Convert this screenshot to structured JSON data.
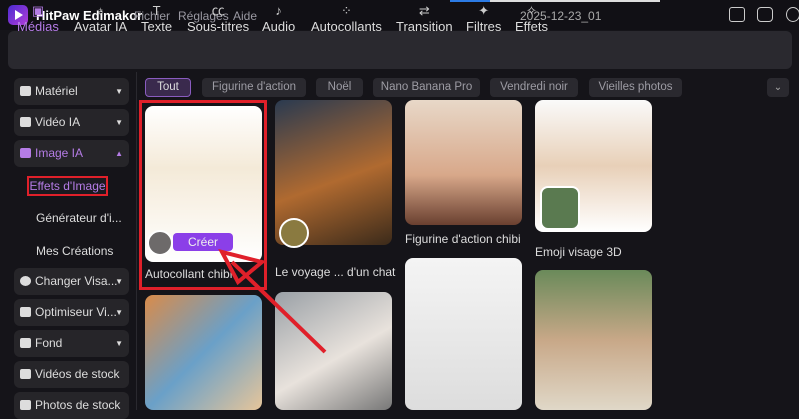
{
  "app": {
    "name": "HitPaw Edimakor",
    "menus": [
      "Fichier",
      "Réglages",
      "Aide"
    ],
    "document": "2025-12-23_01"
  },
  "toolbar": [
    {
      "label": "Médias",
      "icon": "image-icon",
      "active": true
    },
    {
      "label": "Avatar IA",
      "icon": "avatar-icon"
    },
    {
      "label": "Texte",
      "icon": "text-icon"
    },
    {
      "label": "Sous-titres",
      "icon": "subtitles-icon"
    },
    {
      "label": "Audio",
      "icon": "music-icon"
    },
    {
      "label": "Autocollants",
      "icon": "stickers-icon"
    },
    {
      "label": "Transition",
      "icon": "transition-icon"
    },
    {
      "label": "Filtres",
      "icon": "sparkle-icon"
    },
    {
      "label": "Effets",
      "icon": "effects-icon"
    }
  ],
  "chips": [
    "Tout",
    "Figurine d'action",
    "Noël",
    "Nano Banana Pro",
    "Vendredi noir",
    "Vieilles photos"
  ],
  "sidebar": {
    "items": [
      "Matériel",
      "Vidéo IA",
      "Image IA",
      "Changer Visa...",
      "Optimiseur Vi...",
      "Fond",
      "Vidéos de stock",
      "Photos de stock"
    ],
    "sub": [
      "Effets d'Image",
      "Générateur d'i...",
      "Mes Créations"
    ]
  },
  "cards": {
    "c1": "Autocollant chibi",
    "c2": "Le voyage ... d'un chat",
    "c3": "Figurine d'action chibi",
    "c4": "Emoji visage 3D",
    "create": "Créer"
  },
  "colors": {
    "accent": "#b57ce6",
    "highlight": "#e0202a",
    "button": "#8b3fe8"
  }
}
